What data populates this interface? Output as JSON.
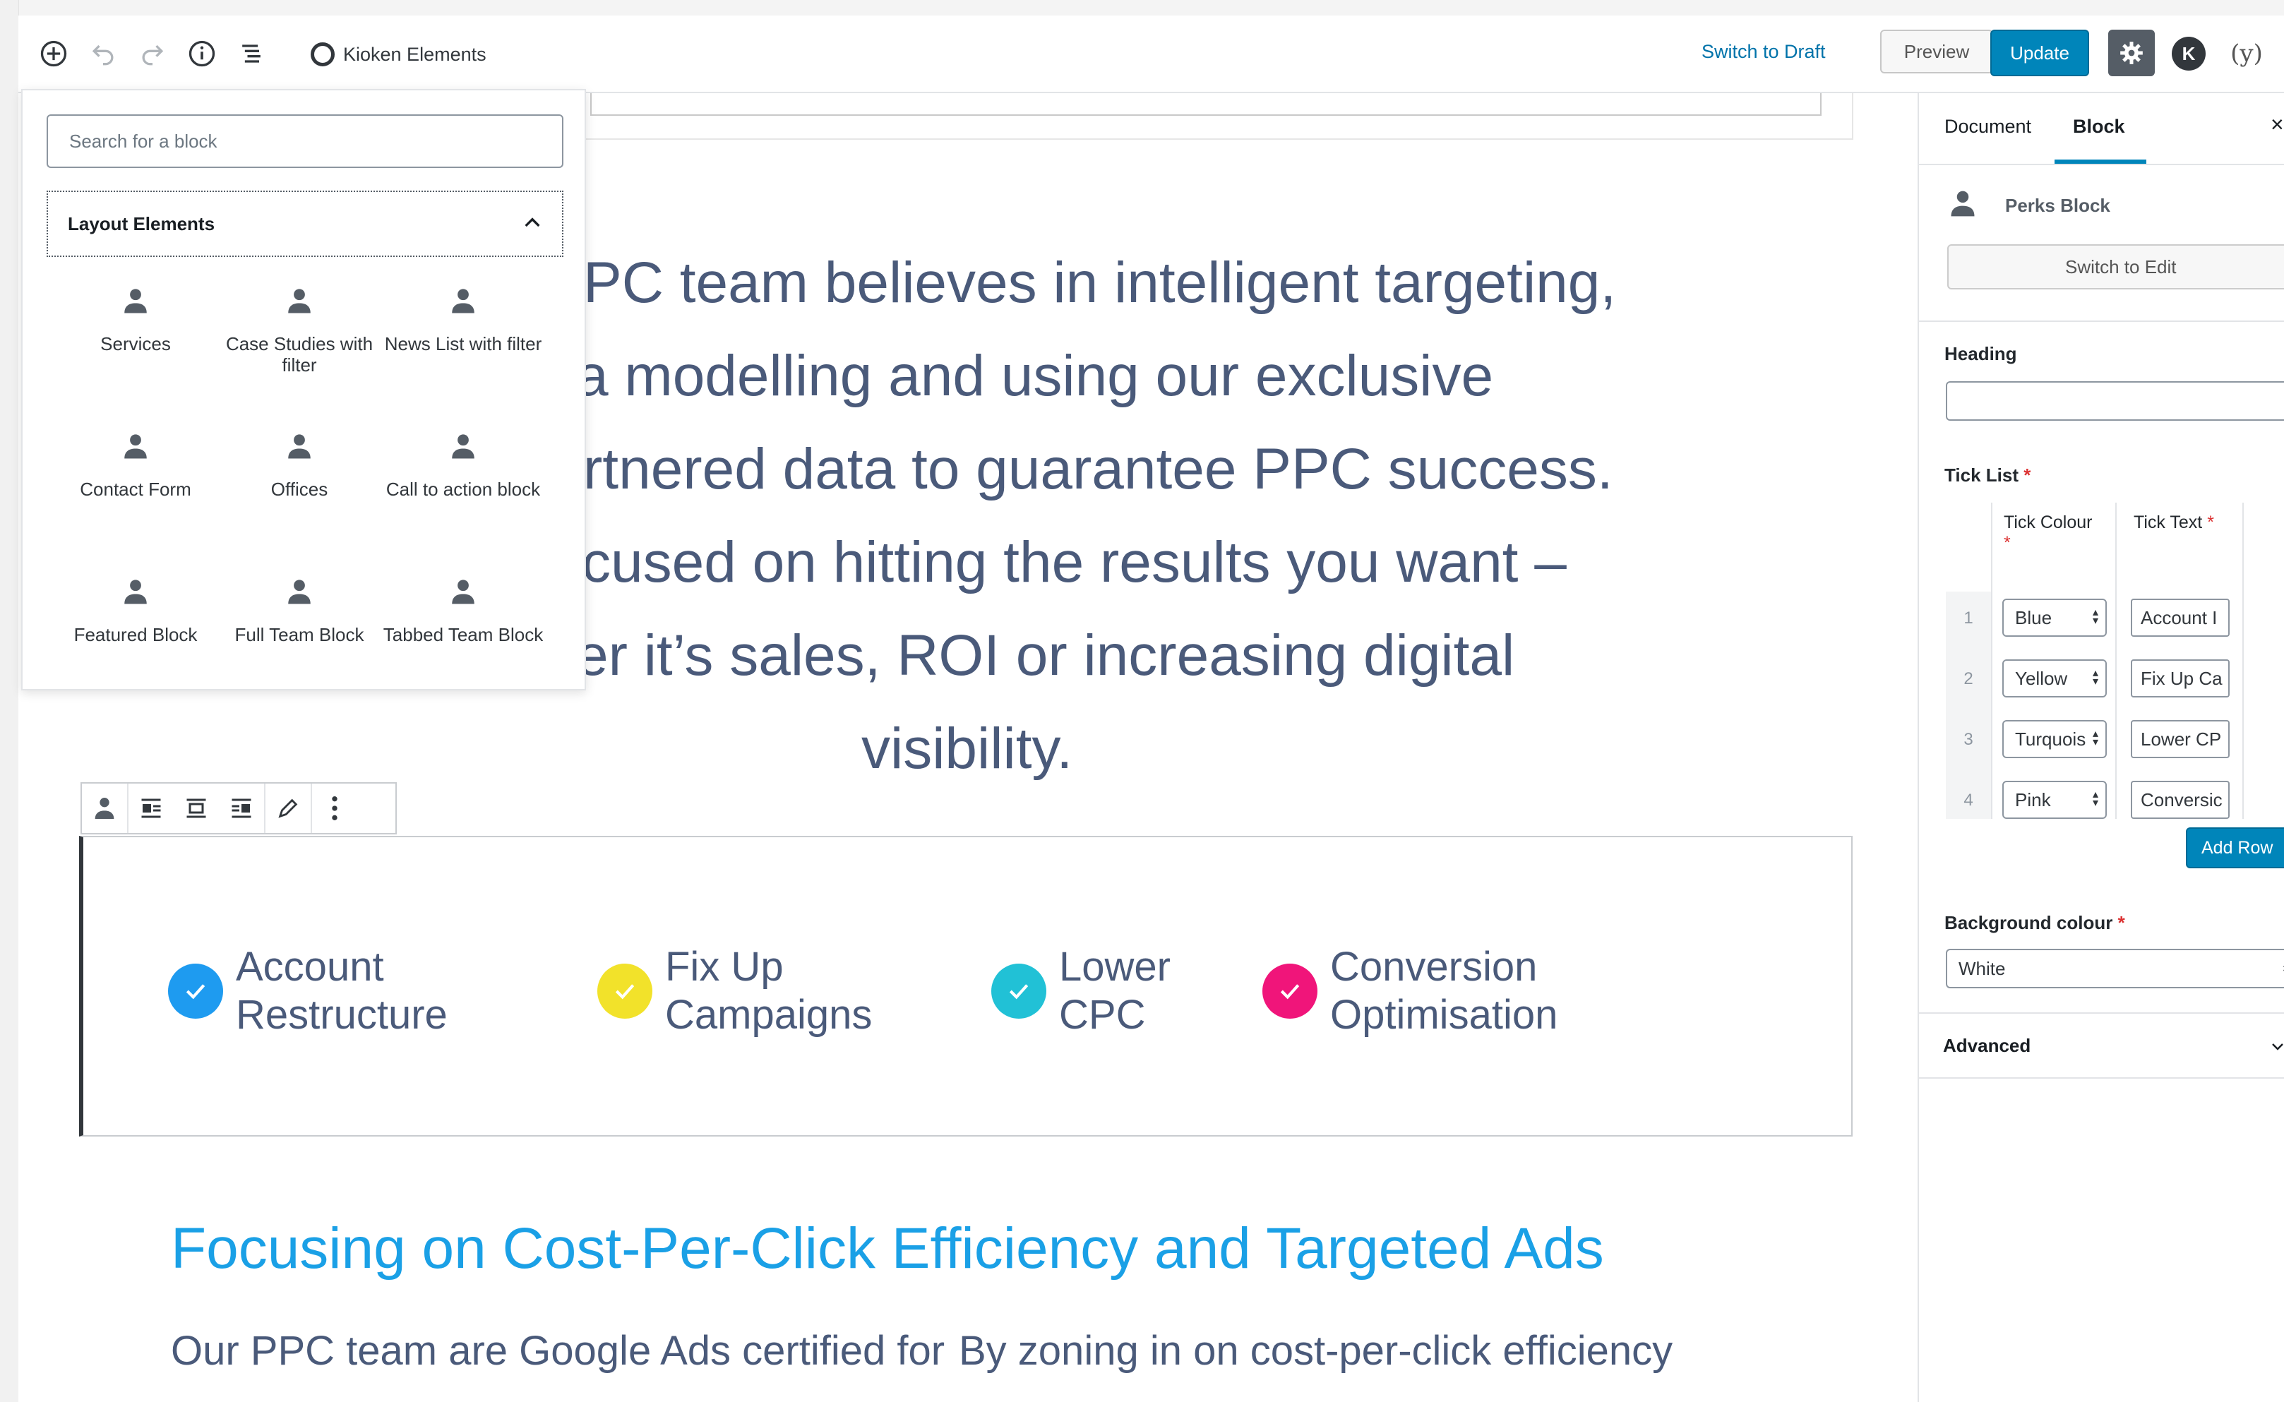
{
  "toolbar": {
    "brand_label": "Kioken Elements",
    "switch_draft": "Switch to Draft",
    "preview": "Preview",
    "update": "Update",
    "icons": [
      "add-block-icon",
      "undo-icon",
      "redo-icon",
      "info-icon",
      "block-navigation-icon",
      "settings-gear-icon",
      "kioken-logo-icon",
      "yoast-icon",
      "more-menu-icon"
    ]
  },
  "inserter": {
    "search_placeholder": "Search for a block",
    "category": "Layout Elements",
    "blocks": [
      {
        "label": "Services"
      },
      {
        "label": "Case Studies with filter"
      },
      {
        "label": "News List with filter"
      },
      {
        "label": "Contact Form"
      },
      {
        "label": "Offices"
      },
      {
        "label": "Call to action block"
      },
      {
        "label": "Featured Block"
      },
      {
        "label": "Full Team Block"
      },
      {
        "label": "Tabbed Team Block"
      }
    ]
  },
  "canvas": {
    "hero_lines": [
      "PC team believes in intelligent targeting,",
      "a modelling and using our exclusive",
      "rtnered data to guarantee PPC success.",
      "cused on hitting the results you want –",
      "er it’s sales, ROI or increasing digital",
      "visibility."
    ],
    "perks": [
      {
        "text": "Account\nRestructure",
        "color": "#1e9bf0"
      },
      {
        "text": "Fix Up\nCampaigns",
        "color": "#f2e22a"
      },
      {
        "text": "Lower\nCPC",
        "color": "#21c1d6"
      },
      {
        "text": "Conversion\nOptimisation",
        "color": "#f0157a"
      }
    ],
    "focus_heading": "Focusing on Cost-Per-Click Efficiency and Targeted Ads",
    "body_col1": "Our PPC team are Google Ads certified for",
    "body_col2": "By zoning in on cost-per-click efficiency"
  },
  "sidebar": {
    "tab_document": "Document",
    "tab_block": "Block",
    "close": "×",
    "block_name": "Perks Block",
    "switch_to_edit": "Switch to Edit",
    "heading_label": "Heading",
    "heading_value": "",
    "tick_list_label": "Tick List",
    "required_mark": "*",
    "col_tick_colour": "Tick Colour",
    "col_tick_text": "Tick Text",
    "rows": [
      {
        "num": "1",
        "colour": "Blue",
        "text": "Account I"
      },
      {
        "num": "2",
        "colour": "Yellow",
        "text": "Fix Up Ca"
      },
      {
        "num": "3",
        "colour": "Turquois",
        "text": "Lower CP"
      },
      {
        "num": "4",
        "colour": "Pink",
        "text": "Conversic"
      }
    ],
    "add_row": "Add Row",
    "bg_label": "Background colour",
    "bg_value": "White",
    "advanced": "Advanced"
  },
  "colors": {
    "accent": "#0085ba",
    "hero_text": "#4a5a7a",
    "heading_blue": "#1aa0e6"
  }
}
